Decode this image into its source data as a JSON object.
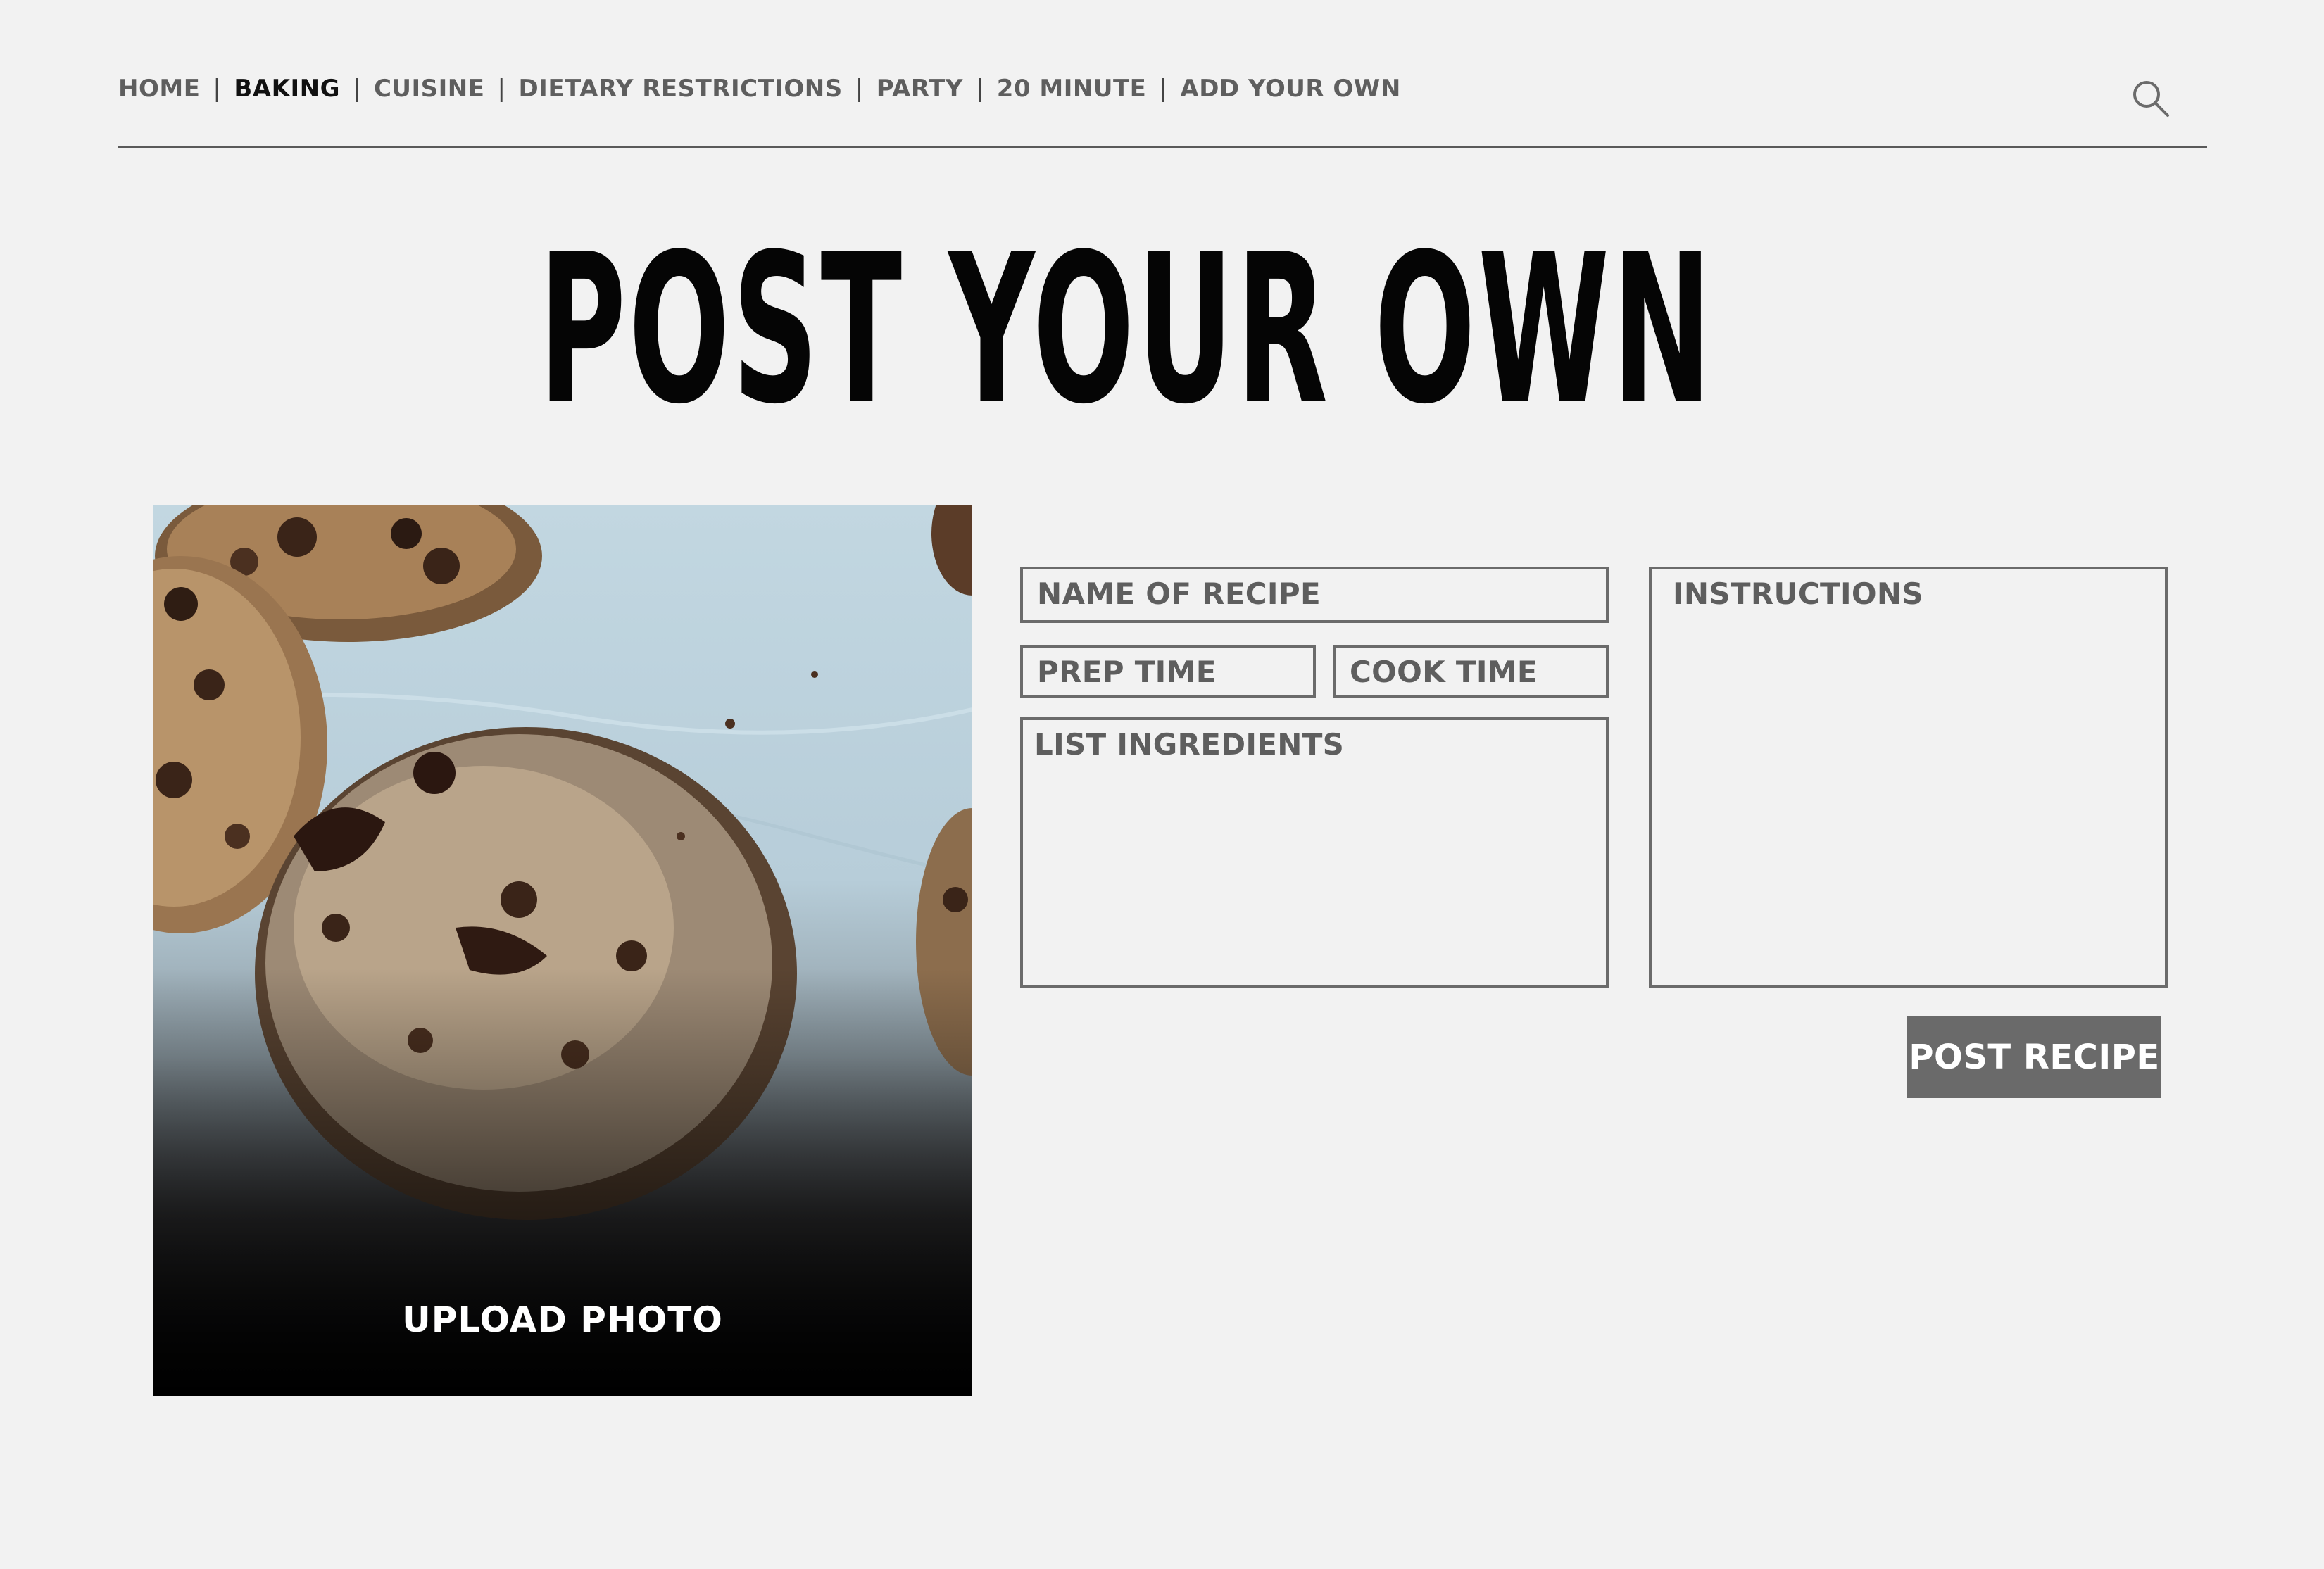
{
  "nav": {
    "items": [
      {
        "label": "HOME"
      },
      {
        "label": "BAKING"
      },
      {
        "label": "CUISINE"
      },
      {
        "label": "DIETARY RESTRICTIONS"
      },
      {
        "label": "PARTY"
      },
      {
        "label": "20 MINUTE"
      },
      {
        "label": "ADD YOUR OWN"
      }
    ],
    "separator": "|",
    "active_item": "BAKING",
    "search_icon": "search-icon"
  },
  "page": {
    "title": "POST YOUR OWN"
  },
  "photo": {
    "upload_label": "UPLOAD PHOTO"
  },
  "form": {
    "name_placeholder": "NAME OF RECIPE",
    "prep_placeholder": "PREP TIME",
    "cook_placeholder": "COOK TIME",
    "ingredients_placeholder": "LIST INGREDIENTS",
    "instructions_placeholder": "INSTRUCTIONS",
    "submit_label": "POST RECIPE"
  },
  "colors": {
    "background": "#f2f2f2",
    "text_gray": "#5e5e5e",
    "border_gray": "#6b6b6b",
    "button_gray": "#6a6a6a",
    "active_nav": "#111111"
  }
}
